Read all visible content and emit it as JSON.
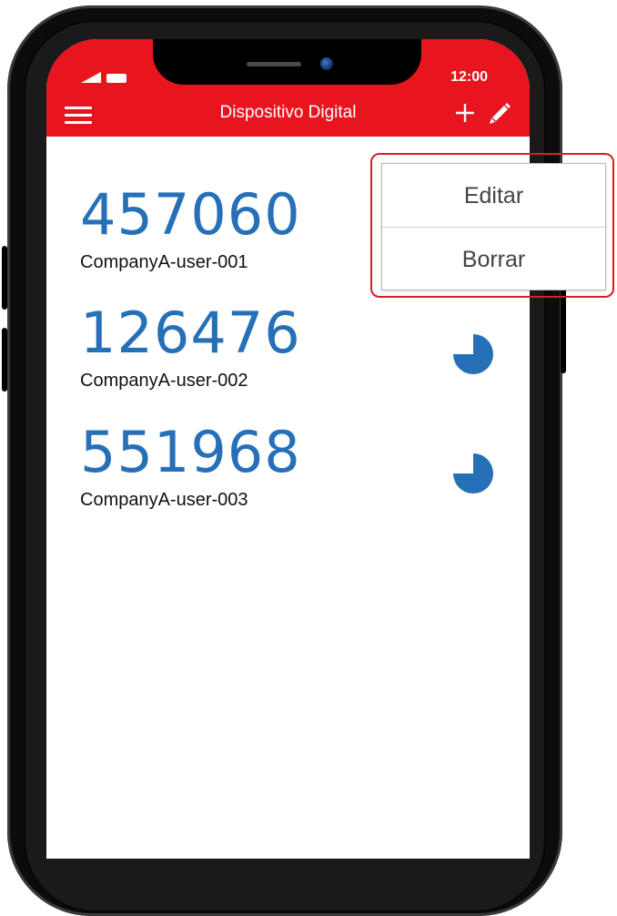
{
  "status_bar": {
    "time": "12:00"
  },
  "header": {
    "title": "Dispositivo Digital"
  },
  "tokens": [
    {
      "code": "457060",
      "user": "CompanyA-user-001"
    },
    {
      "code": "126476",
      "user": "CompanyA-user-002"
    },
    {
      "code": "551968",
      "user": "CompanyA-user-003"
    }
  ],
  "context_menu": {
    "items": [
      "Editar",
      "Borrar"
    ]
  },
  "colors": {
    "header": "#e8141e",
    "code": "#2670b8",
    "highlight": "#d41f2b"
  },
  "icons": [
    "signal-icon",
    "battery-icon",
    "menu-icon",
    "add-icon",
    "edit-icon",
    "timer-icon"
  ]
}
